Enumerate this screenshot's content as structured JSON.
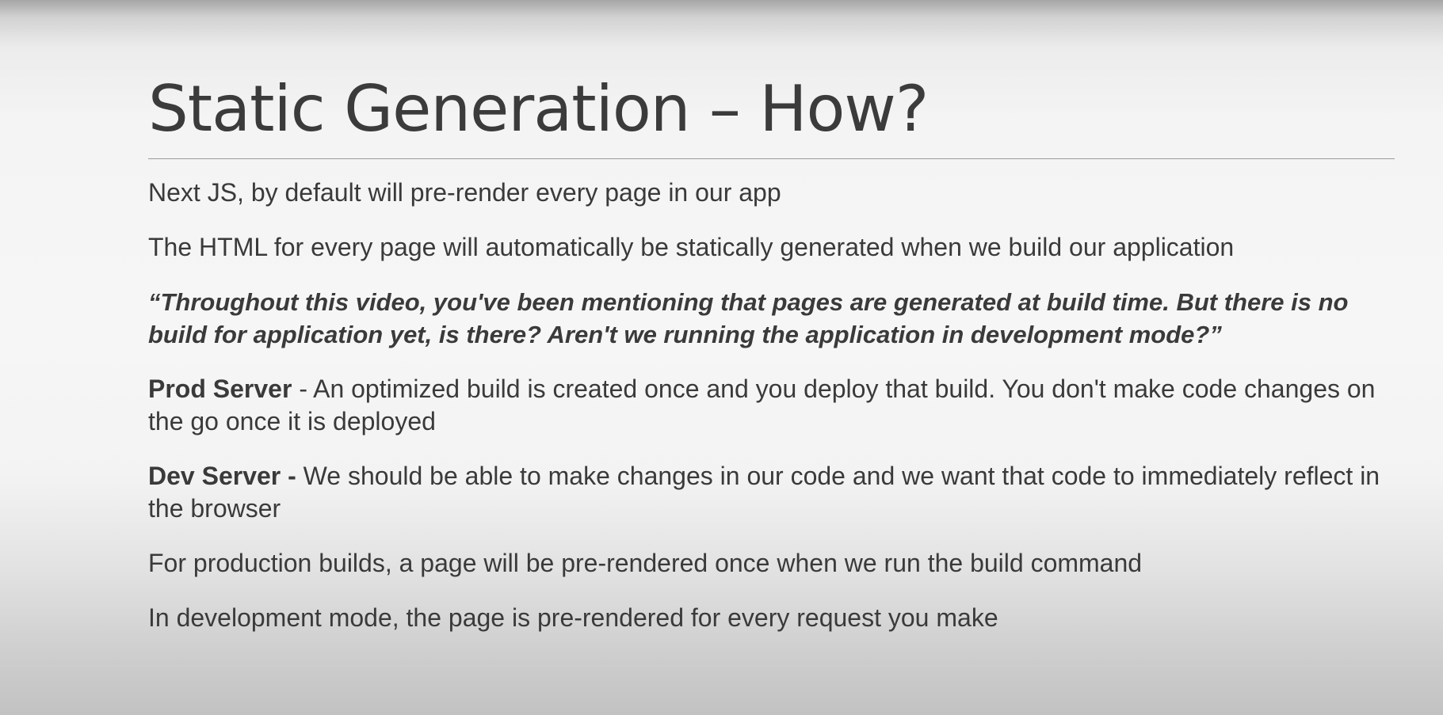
{
  "slide": {
    "title": "Static Generation – How?",
    "paragraphs": {
      "p1": "Next JS, by default will pre-render every page in our app",
      "p2": "The HTML for every page will automatically be statically generated when we build our application",
      "p3": "“Throughout this video, you've been mentioning that pages are generated at build time. But there is no build for application yet, is there? Aren't we running the application in development mode?”",
      "p4": {
        "lead": "Prod Server",
        "text": " - An optimized build is created once and you deploy that build. You don't make code changes on the go once it is deployed"
      },
      "p5": {
        "lead": "Dev Server -",
        "text": " We should be able to make changes in our code and we want that code to immediately reflect in the browser"
      },
      "p6": "For production builds, a page will be pre-rendered once when we run the build command",
      "p7": "In development mode, the page is pre-rendered for every request you make"
    }
  }
}
